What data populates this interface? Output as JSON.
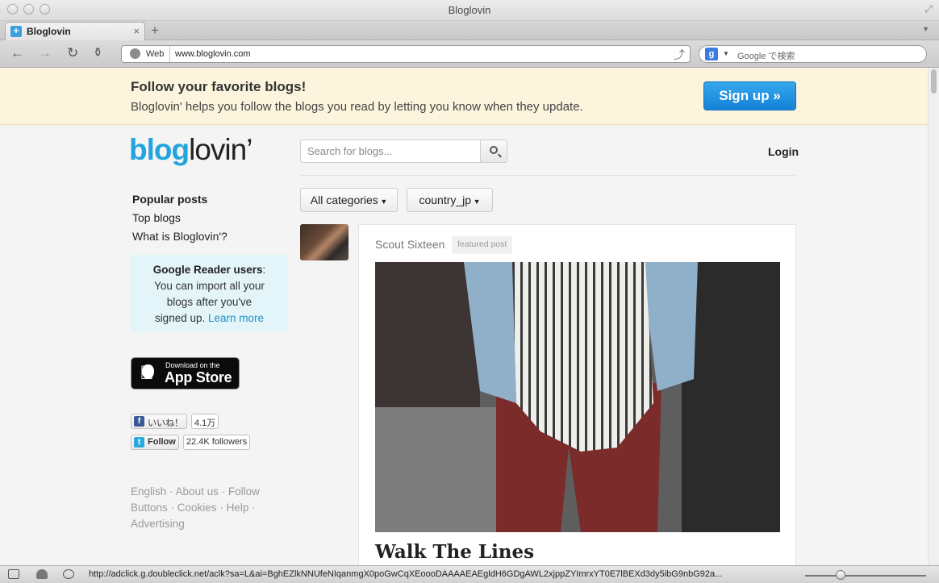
{
  "window": {
    "title": "Bloglovin"
  },
  "tab": {
    "title": "Bloglovin",
    "close": "×",
    "new": "+",
    "menu": "▼",
    "favicon": "+"
  },
  "toolbar": {
    "url_label": "Web",
    "url": "www.bloglovin.com",
    "search_placeholder": "Google で検索",
    "search_engine": "g"
  },
  "banner": {
    "heading": "Follow your favorite blogs!",
    "subtext": "Bloglovin' helps you follow the blogs you read by letting you know when they update.",
    "signup": "Sign up »"
  },
  "header": {
    "logo_part1": "blog",
    "logo_part2": "lovin’",
    "search_placeholder": "Search for blogs...",
    "login": "Login"
  },
  "sidebar": {
    "items": [
      {
        "label": "Popular posts"
      },
      {
        "label": "Top blogs"
      },
      {
        "label": "What is Bloglovin'?"
      }
    ],
    "reader_box": {
      "title": "Google Reader users",
      "line1": "You can import all your",
      "line2": "blogs after you've",
      "line3": "signed up.",
      "link": "Learn more"
    },
    "appstore": {
      "small": "Download on the",
      "big": "App Store"
    },
    "facebook": {
      "label": "いいね！",
      "count": "4.1万"
    },
    "twitter": {
      "label": "Follow",
      "count": "22.4K followers"
    },
    "footer": [
      "English",
      "About us",
      "Follow",
      "Buttons",
      "Cookies",
      "Help",
      "Advertising"
    ]
  },
  "filters": {
    "category": "All categories",
    "country": "country_jp"
  },
  "post": {
    "blog_name": "Scout Sixteen",
    "badge": "featured post",
    "title": "Walk The Lines"
  },
  "statusbar": {
    "url": "http://adclick.g.doubleclick.net/aclk?sa=L&ai=BghEZlkNNUfeNIqanmgX0poGwCqXEoooDAAAAEAEgldH6GDgAWL2xjppZYImrxYT0E7lBEXd3dy5ibG9nbG92a..."
  },
  "colors": {
    "brand_blue": "#23a4dd",
    "signup_blue": "#1582d6",
    "banner_bg": "#fcf4dc",
    "reader_bg": "#e3f5f9",
    "link": "#1e8fc6"
  }
}
